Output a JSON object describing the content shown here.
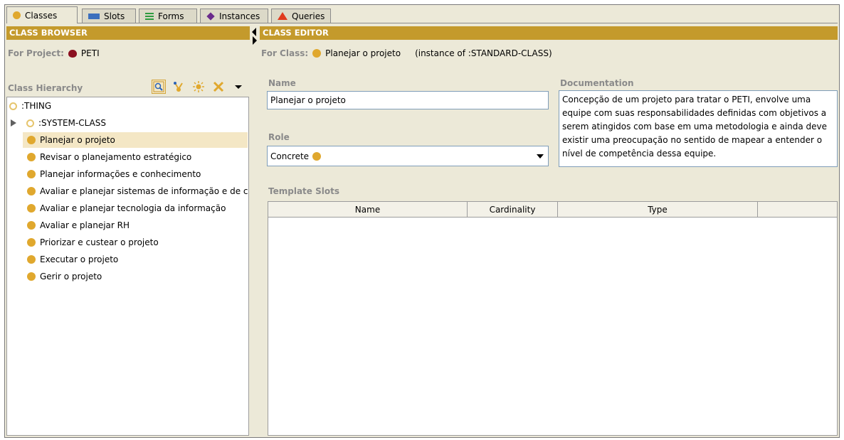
{
  "tabs": [
    {
      "label": "Classes",
      "icon": "class-icon",
      "active": true
    },
    {
      "label": "Slots",
      "icon": "slot-icon",
      "active": false
    },
    {
      "label": "Forms",
      "icon": "forms-icon",
      "active": false
    },
    {
      "label": "Instances",
      "icon": "instance-icon",
      "active": false
    },
    {
      "label": "Queries",
      "icon": "query-icon",
      "active": false
    }
  ],
  "class_browser": {
    "title": "CLASS BROWSER",
    "for_project_label": "For Project:",
    "project_name": "PETI",
    "hierarchy_label": "Class Hierarchy",
    "tree": [
      {
        "label": ":THING",
        "level": 0,
        "icon": "thing-class-icon",
        "expander": false
      },
      {
        "label": ":SYSTEM-CLASS",
        "level": 1,
        "icon": "system-class-icon",
        "expander": true
      },
      {
        "label": "Planejar o projeto",
        "level": 1,
        "selected": true
      },
      {
        "label": "Revisar o planejamento estratégico",
        "level": 1
      },
      {
        "label": "Planejar informações e conhecimento",
        "level": 1
      },
      {
        "label": "Avaliar e planejar sistemas de informação e de c",
        "level": 1
      },
      {
        "label": "Avaliar e planejar tecnologia da informação",
        "level": 1
      },
      {
        "label": "Avaliar e planejar RH",
        "level": 1
      },
      {
        "label": "Priorizar e custear o projeto",
        "level": 1
      },
      {
        "label": "Executar o projeto",
        "level": 1
      },
      {
        "label": "Gerir o projeto",
        "level": 1
      }
    ]
  },
  "class_editor": {
    "title": "CLASS EDITOR",
    "for_class_label": "For Class:",
    "class_name": "Planejar o projeto",
    "instance_of": "(instance of :STANDARD-CLASS)",
    "name_label": "Name",
    "name_value": "Planejar o projeto",
    "role_label": "Role",
    "role_value": "Concrete",
    "documentation_label": "Documentation",
    "documentation_text": "Concepção de um projeto para tratar o PETI, envolve uma equipe com suas responsabilidades definidas com objetivos a serem atingidos com base em uma metodologia e ainda deve existir uma preocupação no sentido de mapear a entender o nível de competência dessa equipe.",
    "template_slots_label": "Template Slots",
    "columns": [
      "Name",
      "Cardinality",
      "Type"
    ]
  },
  "colors": {
    "header": "#c49a2c",
    "class_dot": "#e0a82e",
    "selection": "#f4e7c5"
  }
}
